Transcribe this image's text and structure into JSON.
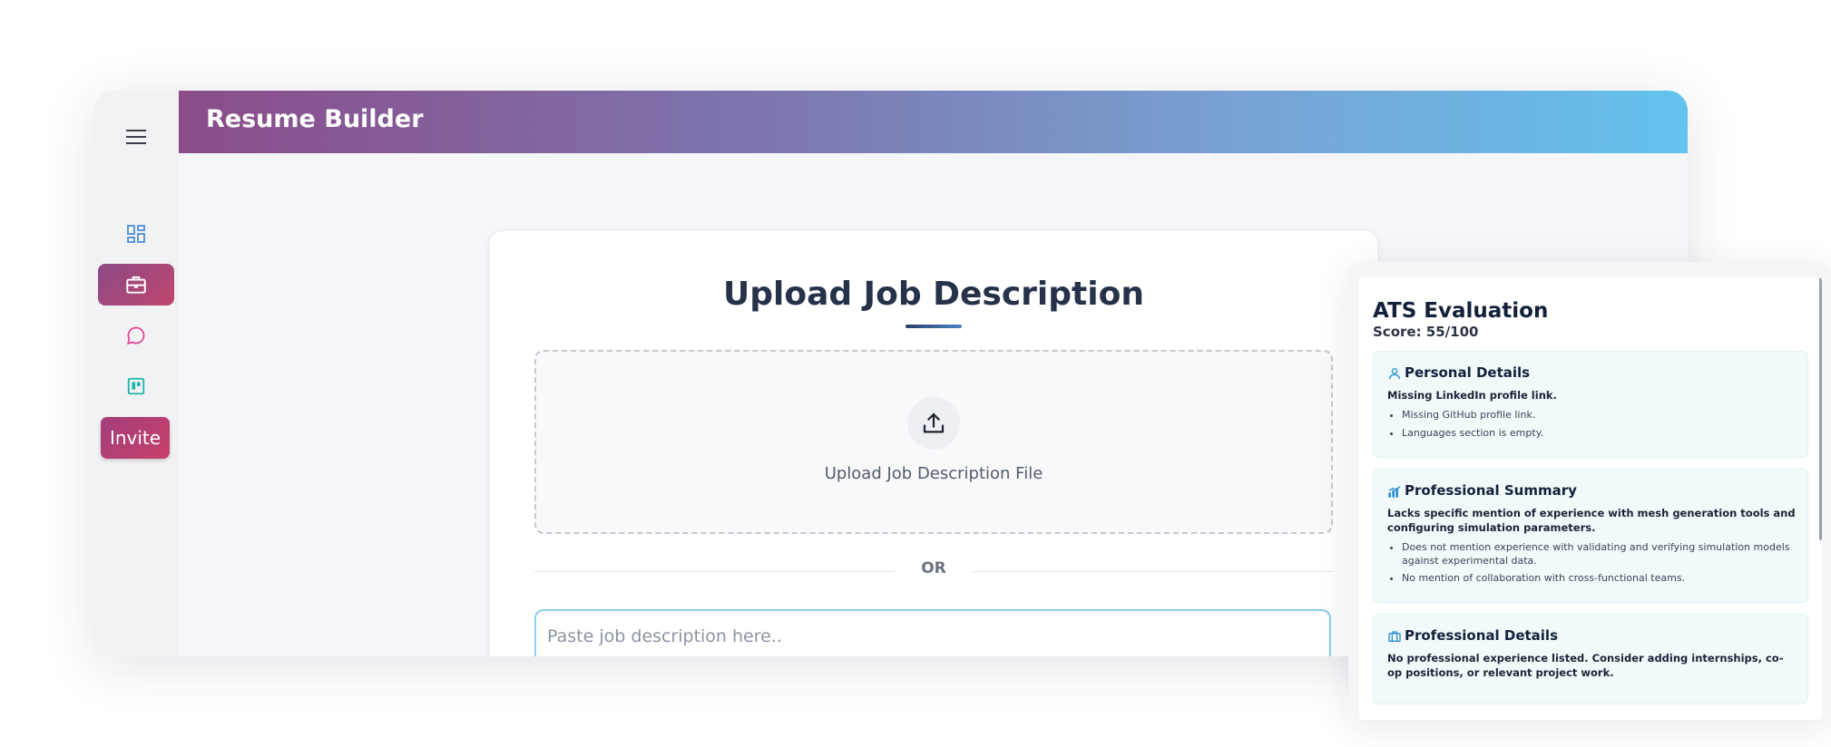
{
  "app": {
    "title": "Resume Builder"
  },
  "sidebar": {
    "items": [
      {
        "icon": "dashboard-icon"
      },
      {
        "icon": "briefcase-icon",
        "active": true
      },
      {
        "icon": "chat-bubble-icon"
      },
      {
        "icon": "board-icon"
      }
    ],
    "invite_label": "Invite"
  },
  "upload": {
    "title": "Upload Job Description",
    "dropzone_label": "Upload Job Description File",
    "or_label": "OR",
    "paste_placeholder": "Paste job description here.."
  },
  "ats": {
    "title": "ATS Evaluation",
    "score": "Score: 55/100",
    "sections": [
      {
        "title": "Personal Details",
        "icon": "person-icon",
        "main": "Missing LinkedIn profile link.",
        "bullets": [
          "Missing GitHub profile link.",
          "Languages section is empty."
        ]
      },
      {
        "title": "Professional Summary",
        "icon": "bar-chart-icon",
        "main": "Lacks specific mention of experience with mesh generation tools and configuring simulation parameters.",
        "bullets": [
          "Does not mention experience with validating and verifying simulation models against experimental data.",
          "No mention of collaboration with cross-functional teams."
        ]
      },
      {
        "title": "Professional Details",
        "icon": "briefcase-icon",
        "main": "No professional experience listed. Consider adding internships, co-op positions, or relevant project work.",
        "bullets": []
      }
    ]
  },
  "colors": {
    "header_gradient_start": "#8a4c8a",
    "header_gradient_end": "#63c2ee",
    "accent_magenta": "#b8446f",
    "panel_bg": "#f1f9fb"
  }
}
